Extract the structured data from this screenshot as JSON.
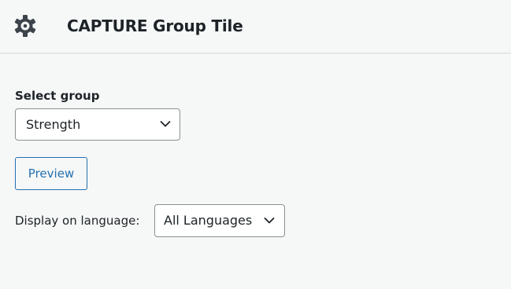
{
  "header": {
    "title": "CAPTURE Group Tile",
    "icon": "gear-icon"
  },
  "group_select": {
    "label": "Select group",
    "value": "Strength"
  },
  "preview_button": {
    "label": "Preview"
  },
  "language_select": {
    "label": "Display on language:",
    "value": "All Languages"
  },
  "colors": {
    "accent": "#2271b1",
    "text": "#1d2327",
    "background": "#f6f7f7",
    "border": "#8c8f94"
  }
}
